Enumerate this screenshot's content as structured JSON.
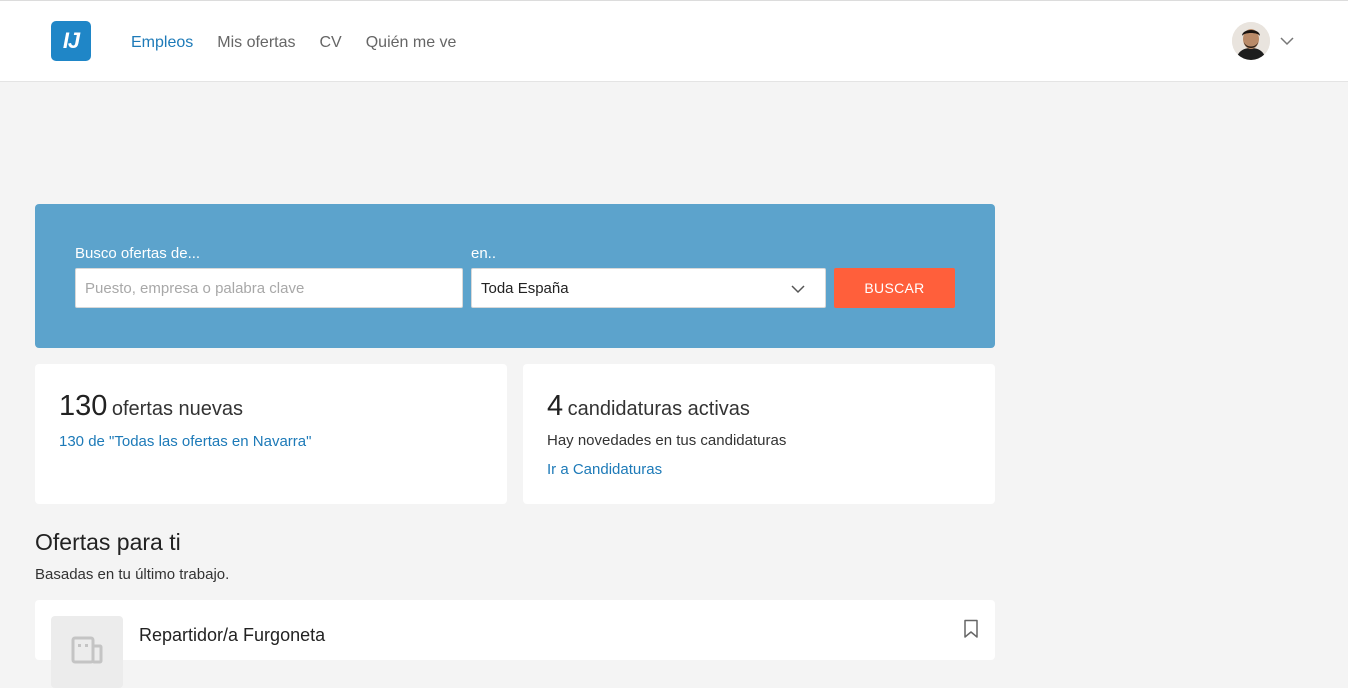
{
  "header": {
    "logo_text": "IJ",
    "nav": [
      {
        "label": "Empleos",
        "active": true
      },
      {
        "label": "Mis ofertas",
        "active": false
      },
      {
        "label": "CV",
        "active": false
      },
      {
        "label": "Quién me ve",
        "active": false
      }
    ],
    "avatar_icon": "user-avatar",
    "menu_icon": "chevron-down-icon"
  },
  "search": {
    "keyword_label": "Busco ofertas de...",
    "keyword_value": "",
    "keyword_placeholder": "Puesto, empresa o palabra clave",
    "location_label": "en..",
    "location_value": "Toda España",
    "button_label": "BUSCAR"
  },
  "stats": {
    "offers": {
      "count": "130",
      "label": "ofertas nuevas",
      "link": "130 de \"Todas las ofertas en Navarra\""
    },
    "applications": {
      "count": "4",
      "label": "candidaturas activas",
      "text": "Hay novedades en tus candidaturas",
      "link": "Ir a Candidaturas"
    }
  },
  "recommendations": {
    "title": "Ofertas para ti",
    "subtitle": "Basadas en tu último trabajo.",
    "jobs": [
      {
        "title": "Repartidor/a Furgoneta",
        "icon": "company-building-icon",
        "bookmark_icon": "bookmark-icon"
      }
    ]
  },
  "colors": {
    "brand": "#1f86c7",
    "link": "#1d7ab8",
    "search_bg": "#5ca3cc",
    "search_button": "#ff5f3b",
    "page_bg": "#f4f4f4"
  }
}
